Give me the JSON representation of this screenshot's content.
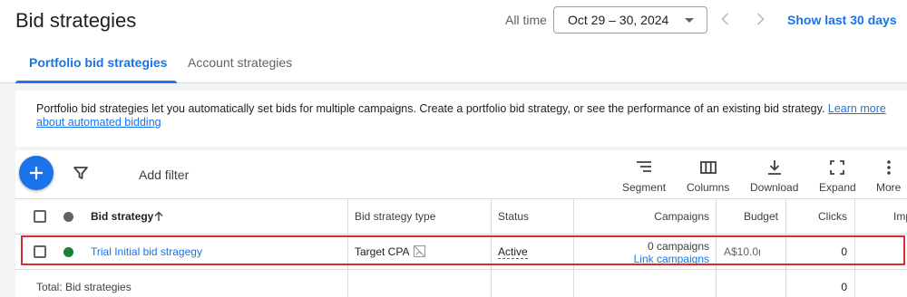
{
  "header": {
    "title": "Bid strategies",
    "range_label": "All time",
    "date_range": "Oct 29 – 30, 2024",
    "show_last": "Show last 30 days"
  },
  "tabs": [
    {
      "label": "Portfolio bid strategies",
      "active": true
    },
    {
      "label": "Account strategies",
      "active": false
    }
  ],
  "info": {
    "text": "Portfolio bid strategies let you automatically set bids for multiple campaigns. Create a portfolio bid strategy, or see the performance of an existing bid strategy.",
    "link": "Learn more about automated bidding"
  },
  "toolbar": {
    "add_filter": "Add filter",
    "tools": [
      {
        "label": "Segment",
        "icon": "segment-icon"
      },
      {
        "label": "Columns",
        "icon": "columns-icon"
      },
      {
        "label": "Download",
        "icon": "download-icon"
      },
      {
        "label": "Expand",
        "icon": "expand-icon"
      },
      {
        "label": "More",
        "icon": "more-vert-icon"
      }
    ]
  },
  "table": {
    "columns": {
      "bid_strategy": "Bid strategy",
      "type": "Bid strategy type",
      "status": "Status",
      "campaigns": "Campaigns",
      "budget": "Budget",
      "clicks": "Clicks",
      "impr": "Imp"
    },
    "rows": [
      {
        "name": "Trial Initial bid stragegy",
        "type": "Target CPA",
        "status": "Active",
        "campaigns": "0 campaigns",
        "campaigns_link": "Link campaigns",
        "budget": "A$10.0(",
        "clicks": "0"
      }
    ],
    "total": {
      "label": "Total: Bid strategies",
      "clicks": "0"
    }
  },
  "colors": {
    "accent": "#1a73e8",
    "status_active": "#188038",
    "highlight": "#d32f2f"
  }
}
